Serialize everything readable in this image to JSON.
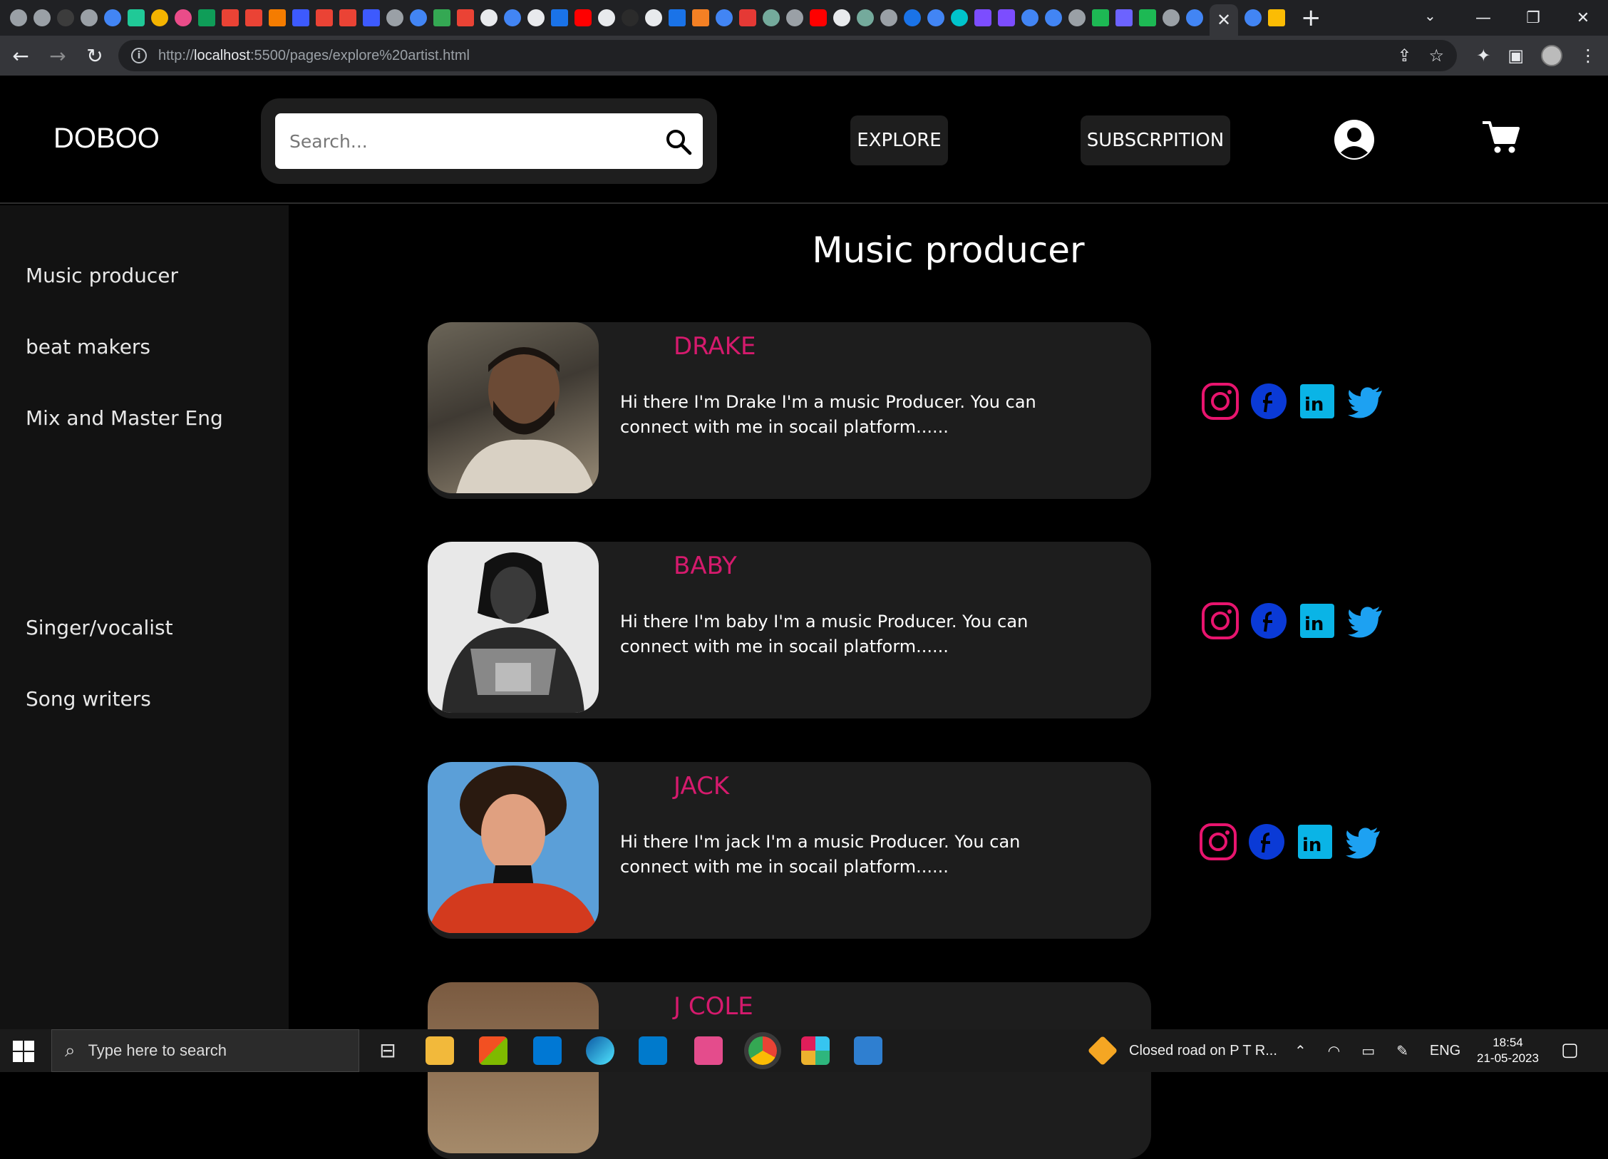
{
  "browser": {
    "url_prefix": "http://",
    "url_host": "localhost",
    "url_rest": ":5500/pages/explore%20artist.html",
    "active_tab_close": "✕",
    "new_tab": "+"
  },
  "header": {
    "logo": "DOBOO",
    "search_placeholder": "Search...",
    "explore_label": "EXPLORE",
    "subscription_label": "SUBSCRPITION"
  },
  "sidebar": {
    "items": [
      {
        "label": "Music producer"
      },
      {
        "label": "beat makers"
      },
      {
        "label": "Mix and Master Eng"
      },
      {
        "label": "Singer/vocalist"
      },
      {
        "label": "Song writers"
      }
    ]
  },
  "main": {
    "title": "Music producer",
    "artists": [
      {
        "name": "DRAKE",
        "bio": "Hi there I'm Drake I'm a music Producer. You can connect with me in socail platform......"
      },
      {
        "name": "BABY",
        "bio": "Hi there I'm baby I'm a music Producer. You can connect with me in socail platform......"
      },
      {
        "name": "JACK",
        "bio": "Hi there I'm jack I'm a music Producer. You can connect with me in socail platform......"
      },
      {
        "name": "J COLE",
        "bio": ""
      }
    ]
  },
  "taskbar": {
    "search_placeholder": "Type here to search",
    "notification": "Closed road on P T R...",
    "language": "ENG",
    "time": "18:54",
    "date": "21-05-2023"
  },
  "colors": {
    "accent_pink": "#d51a6d",
    "instagram": "#e8146e",
    "facebook": "#0a3ad6",
    "linkedin": "#0ab4e6",
    "twitter": "#1da1f2"
  }
}
